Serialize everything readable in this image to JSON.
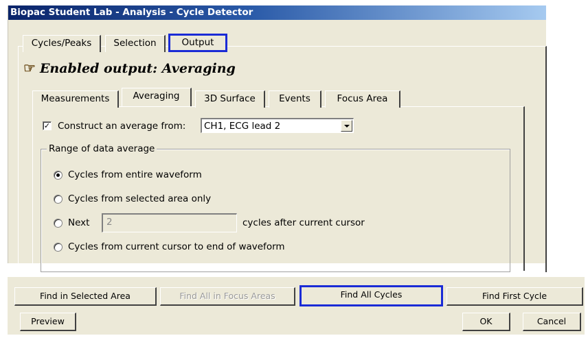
{
  "window": {
    "title": "Biopac Student Lab - Analysis - Cycle Detector"
  },
  "main_tabs": [
    {
      "label": "Cycles/Peaks"
    },
    {
      "label": "Selection"
    },
    {
      "label": "Output",
      "selected": true
    }
  ],
  "output": {
    "heading": "Enabled output: Averaging",
    "hand_icon": "pointing-hand-icon",
    "sub_tabs": [
      {
        "label": "Measurements"
      },
      {
        "label": "Averaging",
        "selected": true
      },
      {
        "label": "3D Surface"
      },
      {
        "label": "Events"
      },
      {
        "label": "Focus Area"
      }
    ],
    "averaging": {
      "construct_checkbox_label": "Construct an average from:",
      "construct_checked": true,
      "source_select_value": "CH1, ECG lead 2",
      "range_group_label": "Range of data average",
      "options": [
        {
          "label": "Cycles from entire waveform",
          "selected": true
        },
        {
          "label": "Cycles from selected area only",
          "selected": false
        },
        {
          "label": "Next",
          "selected": false
        },
        {
          "label": "Cycles from current cursor to end of waveform",
          "selected": false
        }
      ],
      "next_value": "2",
      "next_suffix": "cycles after current cursor"
    }
  },
  "buttons": {
    "find_selected": "Find in Selected Area",
    "find_focus": "Find All in Focus Areas",
    "find_all": "Find All Cycles",
    "find_first": "Find First Cycle",
    "preview": "Preview",
    "ok": "OK",
    "cancel": "Cancel"
  },
  "colors": {
    "focus_box": "#1a2bd6",
    "title_bar": "#0a246a",
    "dialog_bg": "#ece9d8"
  }
}
